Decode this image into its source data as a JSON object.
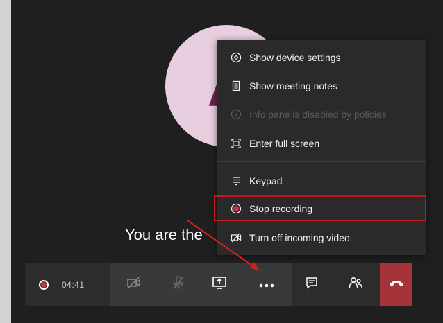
{
  "avatar": {
    "initial": "A"
  },
  "status_text": "You are the",
  "menu": {
    "items": [
      {
        "label": "Show device settings",
        "icon": "gear-icon",
        "disabled": false
      },
      {
        "label": "Show meeting notes",
        "icon": "notes-icon",
        "disabled": false
      },
      {
        "label": "Info pane is disabled by policies",
        "icon": "info-icon",
        "disabled": true
      },
      {
        "label": "Enter full screen",
        "icon": "fullscreen-icon",
        "disabled": false
      },
      {
        "label": "Keypad",
        "icon": "keypad-icon",
        "disabled": false
      },
      {
        "label": "Stop recording",
        "icon": "record-stop-icon",
        "disabled": false
      },
      {
        "label": "Turn off incoming video",
        "icon": "video-off-icon",
        "disabled": false
      }
    ]
  },
  "toolbar": {
    "timer": "04:41",
    "buttons": [
      "camera-off-icon",
      "mic-off-icon",
      "share-screen-icon",
      "more-options-icon",
      "chat-icon",
      "participants-icon",
      "hang-up-icon"
    ]
  },
  "colors": {
    "highlight": "#c4161c",
    "hangup": "#a4343a",
    "record": "#c4314b",
    "avatar_bg": "#e8cfe0",
    "avatar_fg": "#6b2452"
  }
}
